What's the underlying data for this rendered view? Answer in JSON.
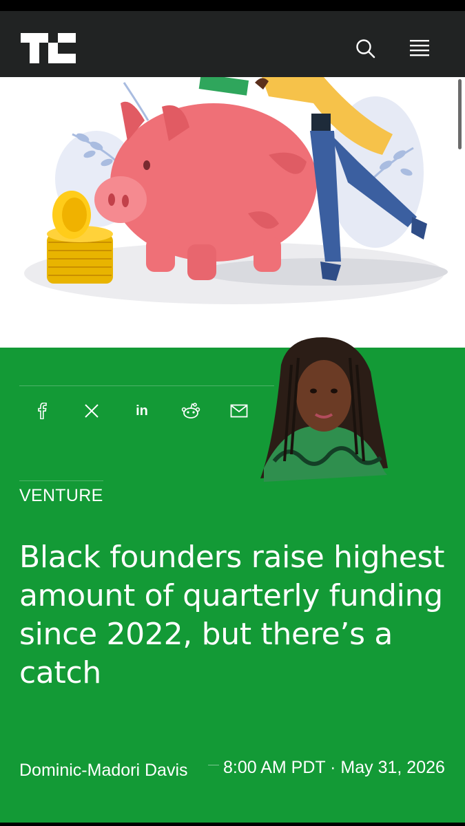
{
  "header": {
    "logo": "TC",
    "search_icon": "search-icon",
    "menu_icon": "hamburger-menu-icon"
  },
  "hero": {
    "illustration": "piggy-bank-illustration"
  },
  "share": {
    "icons": [
      "facebook-icon",
      "x-icon",
      "linkedin-icon",
      "reddit-icon",
      "email-icon"
    ],
    "labels": {
      "facebook": "f",
      "linkedin": "in"
    }
  },
  "article": {
    "category": "VENTURE",
    "headline": "Black founders raise highest amount of quarterly funding since 2022, but there’s a catch",
    "author": "Dominic-Madori Davis",
    "datetime": "8:00 AM PDT · May 31, 2026"
  },
  "colors": {
    "header_bg": "#212323",
    "article_bg": "#139a36",
    "text": "#ffffff"
  }
}
